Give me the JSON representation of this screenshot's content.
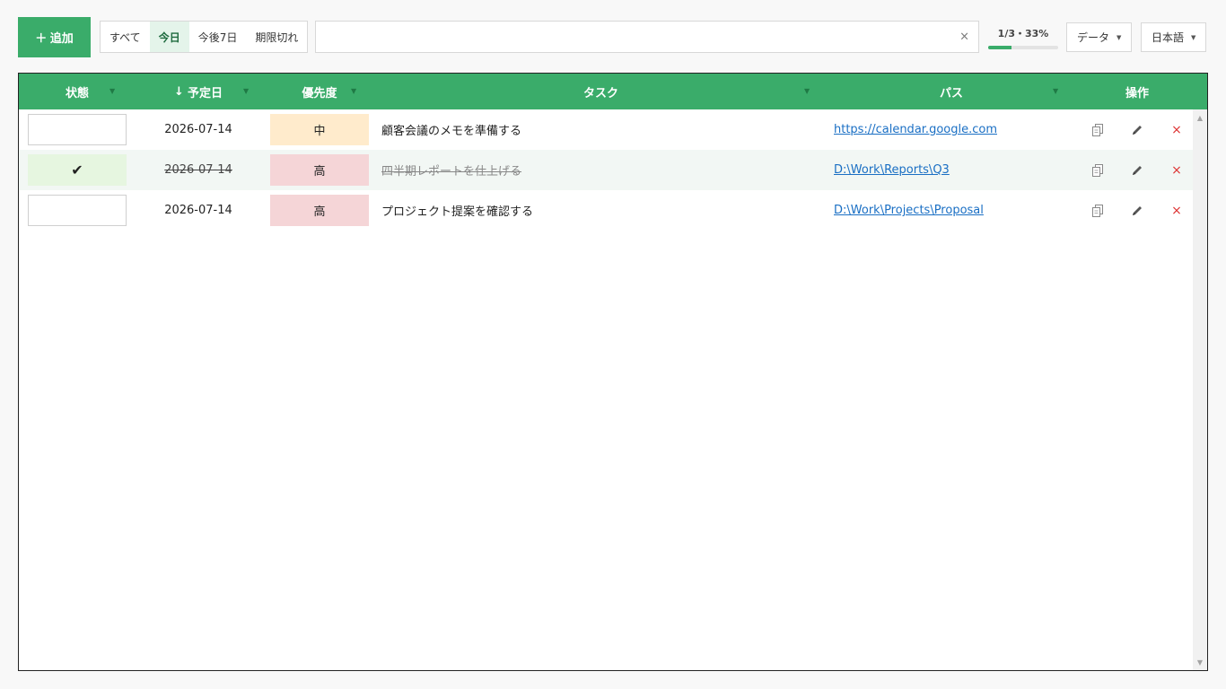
{
  "toolbar": {
    "add_label": "＋ 追加",
    "filters": [
      "すべて",
      "今日",
      "今後7日",
      "期限切れ"
    ],
    "active_filter": "今日",
    "search_value": "",
    "search_clear": "×",
    "progress_text": "1/3・33%",
    "progress_fraction": 0.33,
    "data_menu": "データ",
    "language_menu": "日本語"
  },
  "table": {
    "headers": {
      "status": "状態",
      "due_sort_arrow": "↓",
      "due": "予定日",
      "priority": "優先度",
      "task": "タスク",
      "path": "パス",
      "actions": "操作"
    },
    "rows": [
      {
        "done": false,
        "status_mark": "",
        "due": "2026-07-14",
        "priority": "中",
        "priority_level": "mid",
        "task": "顧客会議のメモを準備する",
        "path": "https://calendar.google.com"
      },
      {
        "done": true,
        "status_mark": "✔",
        "due": "2026-07-14",
        "priority": "高",
        "priority_level": "high",
        "task": "四半期レポートを仕上げる",
        "path": "D:\\Work\\Reports\\Q3"
      },
      {
        "done": false,
        "status_mark": "",
        "due": "2026-07-14",
        "priority": "高",
        "priority_level": "high",
        "task": "プロジェクト提案を確認する",
        "path": "D:\\Work\\Projects\\Proposal"
      }
    ],
    "icons": {
      "copy": "copy-icon",
      "edit": "pencil-icon",
      "delete": "close-icon"
    },
    "delete_glyph": "×"
  },
  "colors": {
    "accent": "#3aac6a",
    "priority_mid": "#ffebcc",
    "priority_high": "#f5d5d7",
    "done_status": "#e6f6e0",
    "link": "#1a6fc4",
    "delete": "#dd3333"
  }
}
